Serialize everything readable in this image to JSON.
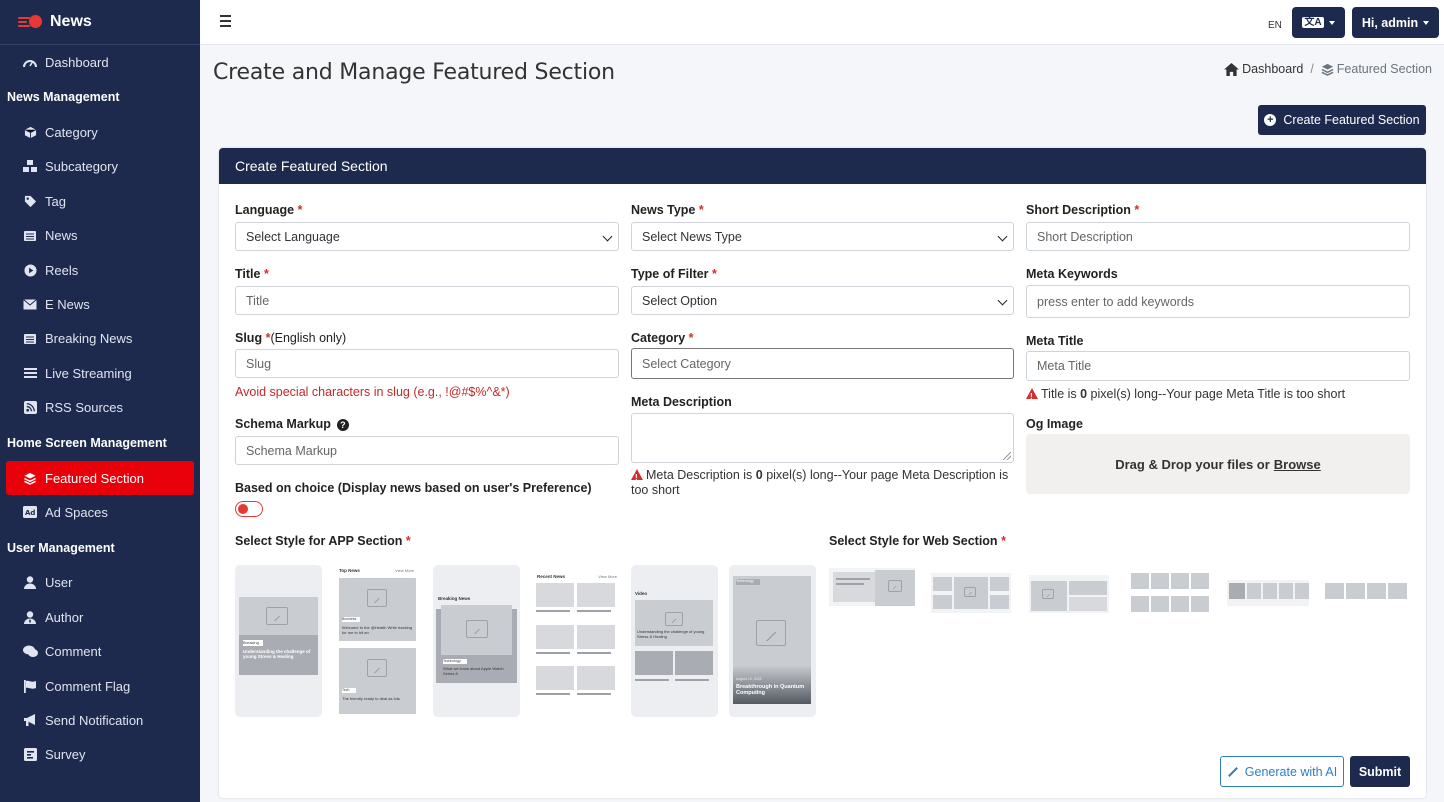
{
  "brand": {
    "name": "News"
  },
  "sidebar": {
    "items": [
      {
        "type": "item",
        "label": "Dashboard",
        "icon": "dashboard-icon"
      },
      {
        "type": "head",
        "label": "News Management"
      },
      {
        "type": "item",
        "label": "Category",
        "icon": "cube-icon"
      },
      {
        "type": "item",
        "label": "Subcategory",
        "icon": "cubes-icon"
      },
      {
        "type": "item",
        "label": "Tag",
        "icon": "tag-icon"
      },
      {
        "type": "item",
        "label": "News",
        "icon": "newspaper-icon"
      },
      {
        "type": "item",
        "label": "Reels",
        "icon": "play-circle-icon"
      },
      {
        "type": "item",
        "label": "E News",
        "icon": "envelope-icon"
      },
      {
        "type": "item",
        "label": "Breaking News",
        "icon": "newspaper-icon"
      },
      {
        "type": "item",
        "label": "Live Streaming",
        "icon": "list-icon"
      },
      {
        "type": "item",
        "label": "RSS Sources",
        "icon": "rss-icon"
      },
      {
        "type": "head",
        "label": "Home Screen Management"
      },
      {
        "type": "item",
        "label": "Featured Section",
        "icon": "layers-icon",
        "active": true
      },
      {
        "type": "item",
        "label": "Ad Spaces",
        "icon": "ad-icon"
      },
      {
        "type": "head",
        "label": "User Management"
      },
      {
        "type": "item",
        "label": "User",
        "icon": "user-icon"
      },
      {
        "type": "item",
        "label": "Author",
        "icon": "user-tie-icon"
      },
      {
        "type": "item",
        "label": "Comment",
        "icon": "comments-icon"
      },
      {
        "type": "item",
        "label": "Comment Flag",
        "icon": "flag-icon"
      },
      {
        "type": "item",
        "label": "Send Notification",
        "icon": "bullhorn-icon"
      },
      {
        "type": "item",
        "label": "Survey",
        "icon": "poll-icon"
      }
    ]
  },
  "topbar": {
    "lang_code": "EN",
    "lang_button": "文A",
    "user_greeting": "Hi, admin"
  },
  "page": {
    "title": "Create and Manage Featured Section",
    "breadcrumb": {
      "home": "Dashboard",
      "separator": "/",
      "current": "Featured Section"
    },
    "create_button": "Create Featured Section"
  },
  "card": {
    "title": "Create Featured Section",
    "required_mark": "*",
    "fields": {
      "language": {
        "label": "Language",
        "value": "Select Language"
      },
      "title": {
        "label": "Title",
        "placeholder": "Title"
      },
      "slug": {
        "label": "Slug",
        "note": "(English only)",
        "placeholder": "Slug",
        "hint": "Avoid special characters in slug (e.g., !@#$%^&*)"
      },
      "schema": {
        "label": "Schema Markup",
        "placeholder": "Schema Markup"
      },
      "based_on_choice": {
        "label": "Based on choice (Display news based on user's Preference)",
        "enabled": false
      },
      "news_type": {
        "label": "News Type",
        "value": "Select News Type"
      },
      "filter_type": {
        "label": "Type of Filter",
        "value": "Select Option"
      },
      "category": {
        "label": "Category",
        "placeholder": "Select Category"
      },
      "meta_description": {
        "label": "Meta Description",
        "warning_pre": "Meta Description is ",
        "warning_count": "0",
        "warning_post": " pixel(s) long--Your page Meta Description is too short"
      },
      "short_description": {
        "label": "Short Description",
        "placeholder": "Short Description"
      },
      "meta_keywords": {
        "label": "Meta Keywords",
        "placeholder": "press enter to add keywords"
      },
      "meta_title": {
        "label": "Meta Title",
        "placeholder": "Meta Title",
        "warning_pre": "Title is ",
        "warning_count": "0",
        "warning_post": " pixel(s) long--Your page Meta Title is too short"
      },
      "og_image": {
        "label": "Og Image",
        "drop_text": "Drag & Drop your files or",
        "browse": "Browse"
      }
    },
    "app_style": {
      "label": "Select Style for APP Section",
      "styles": [
        {
          "name": "style-1",
          "texts": [
            "Breaking",
            "Understanding the challenge of young Stress & Healing"
          ]
        },
        {
          "name": "style-2",
          "texts": [
            "Top News",
            "View More",
            "Business",
            "Welcome to the @Health Write tracking for me to hit an",
            "Tech",
            "The friendly ready to deal as lots"
          ]
        },
        {
          "name": "style-3",
          "texts": [
            "Breaking News",
            "Technology",
            "What we know about Apple Watch Series 8"
          ]
        },
        {
          "name": "style-4",
          "texts": [
            "Recent News",
            "View More"
          ]
        },
        {
          "name": "style-5",
          "texts": [
            "Video",
            "Understanding the challenge of young Stress & Healing"
          ]
        },
        {
          "name": "style-6",
          "texts": [
            "Technology",
            "August 10, 2023",
            "Breakthrough in Quantum Computing"
          ]
        }
      ]
    },
    "web_style": {
      "label": "Select Style for Web Section"
    },
    "ai_button": "Generate with AI",
    "submit_button": "Submit"
  },
  "colors": {
    "navy": "#1d2a4d",
    "accent_red": "#e8000b",
    "required_red": "#d32f2f",
    "link_blue": "#2f7ec7"
  }
}
